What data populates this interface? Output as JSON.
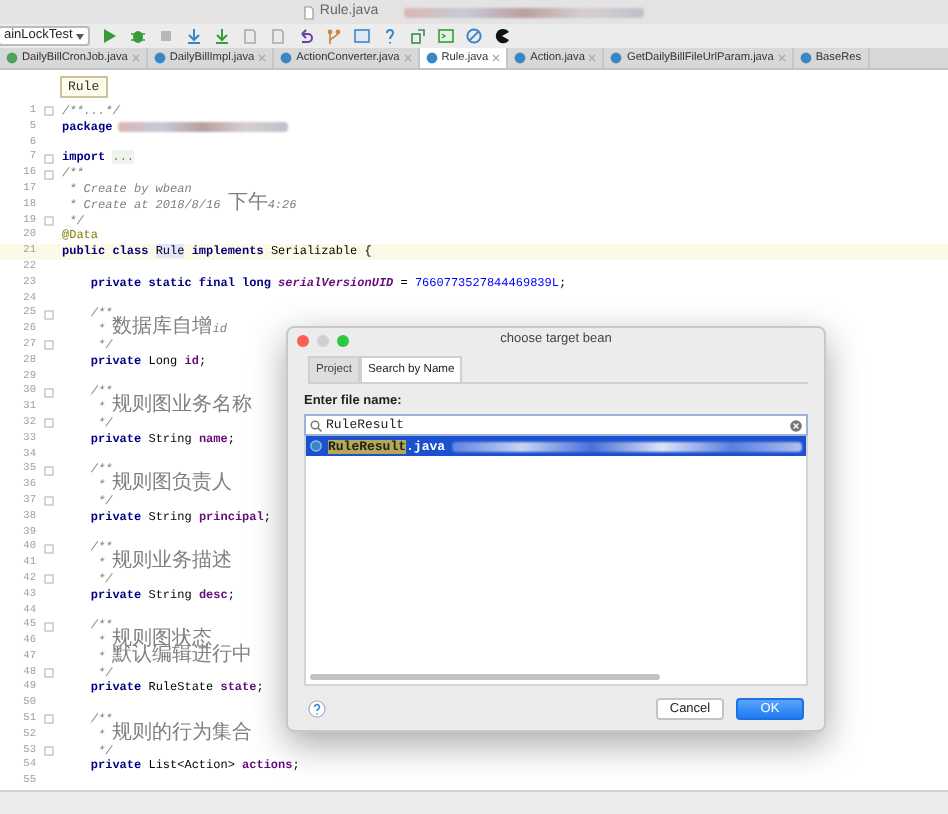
{
  "window": {
    "title": "Rule.java"
  },
  "toolbar": {
    "run_config": "ainLockTest"
  },
  "editor_tabs": [
    {
      "label": "DailyBillCronJob.java",
      "kind": "interface",
      "selected": false
    },
    {
      "label": "DailyBillImpl.java",
      "kind": "class",
      "selected": false
    },
    {
      "label": "ActionConverter.java",
      "kind": "class",
      "selected": false
    },
    {
      "label": "Rule.java",
      "kind": "class",
      "selected": true
    },
    {
      "label": "Action.java",
      "kind": "class",
      "selected": false
    },
    {
      "label": "GetDailyBillFileUrlParam.java",
      "kind": "class",
      "selected": false
    },
    {
      "label": "BaseRes",
      "kind": "class",
      "selected": false
    }
  ],
  "breadcrumb": "Rule",
  "code_lines": [
    {
      "number": "1",
      "fold": true,
      "current": false,
      "tokens": [
        {
          "kind": "comment",
          "text": "/**...*/"
        }
      ]
    },
    {
      "number": "5",
      "fold": false,
      "current": false,
      "tokens": [
        {
          "kind": "keyword",
          "text": "package"
        },
        {
          "kind": "redacted"
        }
      ]
    },
    {
      "number": "6",
      "fold": false,
      "current": false
    },
    {
      "number": "7",
      "fold": true,
      "current": false,
      "tokens": [
        {
          "kind": "keyword",
          "text": "import "
        },
        {
          "kind": "folded",
          "text": "..."
        }
      ]
    },
    {
      "number": "16",
      "fold": true,
      "current": false,
      "tokens": [
        {
          "kind": "comment",
          "text": "/**"
        }
      ]
    },
    {
      "number": "17",
      "fold": false,
      "current": false,
      "tokens": [
        {
          "kind": "comment",
          "text": " * Create by wbean"
        }
      ]
    },
    {
      "number": "18",
      "fold": false,
      "current": false,
      "tokens": [
        {
          "kind": "comment",
          "text": " * Create at 2018/8/16 下午4:26"
        }
      ]
    },
    {
      "number": "19",
      "fold": true,
      "current": false,
      "tokens": [
        {
          "kind": "comment",
          "text": " */"
        }
      ]
    },
    {
      "number": "20",
      "fold": false,
      "current": false,
      "tokens": [
        {
          "kind": "annotation",
          "text": "@Data"
        }
      ]
    },
    {
      "number": "21",
      "fold": false,
      "current": true,
      "tokens": [
        {
          "kind": "keyword",
          "text": "public class "
        },
        {
          "kind": "usage",
          "text": "Rule"
        },
        {
          "kind": "keyword",
          "text": " implements "
        },
        {
          "kind": "plain",
          "text": "Serializable {"
        }
      ]
    },
    {
      "number": "22",
      "fold": false,
      "current": false
    },
    {
      "number": "23",
      "fold": false,
      "current": false,
      "tokens": [
        {
          "kind": "keyword",
          "text": "    private static final long "
        },
        {
          "kind": "static",
          "text": "serialVersionUID"
        },
        {
          "kind": "plain",
          "text": " = "
        },
        {
          "kind": "number",
          "text": "7660773527844469839L"
        },
        {
          "kind": "plain",
          "text": ";"
        }
      ]
    },
    {
      "number": "24",
      "fold": false,
      "current": false
    },
    {
      "number": "25",
      "fold": true,
      "current": false,
      "tokens": [
        {
          "kind": "comment",
          "text": "    /**"
        }
      ]
    },
    {
      "number": "26",
      "fold": false,
      "current": false,
      "tokens": [
        {
          "kind": "comment",
          "text": "     * 数据库自增id"
        }
      ]
    },
    {
      "number": "27",
      "fold": true,
      "current": false,
      "tokens": [
        {
          "kind": "comment",
          "text": "     */"
        }
      ]
    },
    {
      "number": "28",
      "fold": false,
      "current": false,
      "tokens": [
        {
          "kind": "keyword",
          "text": "    private "
        },
        {
          "kind": "plain",
          "text": "Long "
        },
        {
          "kind": "field",
          "text": "id"
        },
        {
          "kind": "plain",
          "text": ";"
        }
      ]
    },
    {
      "number": "29",
      "fold": false,
      "current": false
    },
    {
      "number": "30",
      "fold": true,
      "current": false,
      "tokens": [
        {
          "kind": "comment",
          "text": "    /**"
        }
      ]
    },
    {
      "number": "31",
      "fold": false,
      "current": false,
      "tokens": [
        {
          "kind": "comment",
          "text": "     * 规则图业务名称"
        }
      ]
    },
    {
      "number": "32",
      "fold": true,
      "current": false,
      "tokens": [
        {
          "kind": "comment",
          "text": "     */"
        }
      ]
    },
    {
      "number": "33",
      "fold": false,
      "current": false,
      "tokens": [
        {
          "kind": "keyword",
          "text": "    private "
        },
        {
          "kind": "plain",
          "text": "String "
        },
        {
          "kind": "field",
          "text": "name"
        },
        {
          "kind": "plain",
          "text": ";"
        }
      ]
    },
    {
      "number": "34",
      "fold": false,
      "current": false
    },
    {
      "number": "35",
      "fold": true,
      "current": false,
      "tokens": [
        {
          "kind": "comment",
          "text": "    /**"
        }
      ]
    },
    {
      "number": "36",
      "fold": false,
      "current": false,
      "tokens": [
        {
          "kind": "comment",
          "text": "     * 规则图负责人"
        }
      ]
    },
    {
      "number": "37",
      "fold": true,
      "current": false,
      "tokens": [
        {
          "kind": "comment",
          "text": "     */"
        }
      ]
    },
    {
      "number": "38",
      "fold": false,
      "current": false,
      "tokens": [
        {
          "kind": "keyword",
          "text": "    private "
        },
        {
          "kind": "plain",
          "text": "String "
        },
        {
          "kind": "field",
          "text": "principal"
        },
        {
          "kind": "plain",
          "text": ";"
        }
      ]
    },
    {
      "number": "39",
      "fold": false,
      "current": false
    },
    {
      "number": "40",
      "fold": true,
      "current": false,
      "tokens": [
        {
          "kind": "comment",
          "text": "    /**"
        }
      ]
    },
    {
      "number": "41",
      "fold": false,
      "current": false,
      "tokens": [
        {
          "kind": "comment",
          "text": "     * 规则业务描述"
        }
      ]
    },
    {
      "number": "42",
      "fold": true,
      "current": false,
      "tokens": [
        {
          "kind": "comment",
          "text": "     */"
        }
      ]
    },
    {
      "number": "43",
      "fold": false,
      "current": false,
      "tokens": [
        {
          "kind": "keyword",
          "text": "    private "
        },
        {
          "kind": "plain",
          "text": "String "
        },
        {
          "kind": "field",
          "text": "desc"
        },
        {
          "kind": "plain",
          "text": ";"
        }
      ]
    },
    {
      "number": "44",
      "fold": false,
      "current": false
    },
    {
      "number": "45",
      "fold": true,
      "current": false,
      "tokens": [
        {
          "kind": "comment",
          "text": "    /**"
        }
      ]
    },
    {
      "number": "46",
      "fold": false,
      "current": false,
      "tokens": [
        {
          "kind": "comment",
          "text": "     * 规则图状态"
        }
      ]
    },
    {
      "number": "47",
      "fold": false,
      "current": false,
      "tokens": [
        {
          "kind": "comment",
          "text": "     * 默认编辑进行中"
        }
      ]
    },
    {
      "number": "48",
      "fold": true,
      "current": false,
      "tokens": [
        {
          "kind": "comment",
          "text": "     */"
        }
      ]
    },
    {
      "number": "49",
      "fold": false,
      "current": false,
      "tokens": [
        {
          "kind": "keyword",
          "text": "    private "
        },
        {
          "kind": "plain",
          "text": "RuleState "
        },
        {
          "kind": "field",
          "text": "state"
        },
        {
          "kind": "plain",
          "text": ";"
        }
      ]
    },
    {
      "number": "50",
      "fold": false,
      "current": false
    },
    {
      "number": "51",
      "fold": true,
      "current": false,
      "tokens": [
        {
          "kind": "comment",
          "text": "    /**"
        }
      ]
    },
    {
      "number": "52",
      "fold": false,
      "current": false,
      "tokens": [
        {
          "kind": "comment",
          "text": "     * 规则的行为集合"
        }
      ]
    },
    {
      "number": "53",
      "fold": true,
      "current": false,
      "tokens": [
        {
          "kind": "comment",
          "text": "     */"
        }
      ]
    },
    {
      "number": "54",
      "fold": false,
      "current": false,
      "tokens": [
        {
          "kind": "keyword",
          "text": "    private "
        },
        {
          "kind": "plain",
          "text": "List<Action> "
        },
        {
          "kind": "field",
          "text": "actions"
        },
        {
          "kind": "plain",
          "text": ";"
        }
      ]
    },
    {
      "number": "55",
      "fold": false,
      "current": false
    }
  ],
  "dialog": {
    "title": "choose target bean",
    "tabs": [
      {
        "label": "Project",
        "selected": false
      },
      {
        "label": "Search by Name",
        "selected": true
      }
    ],
    "prompt": "Enter file name:",
    "search": {
      "value": "RuleResult"
    },
    "results": [
      {
        "match": "RuleResult",
        "rest": ".java",
        "selected": true
      }
    ],
    "buttons": [
      {
        "label": "Cancel",
        "kind": "secondary"
      },
      {
        "label": "OK",
        "kind": "primary"
      }
    ]
  }
}
